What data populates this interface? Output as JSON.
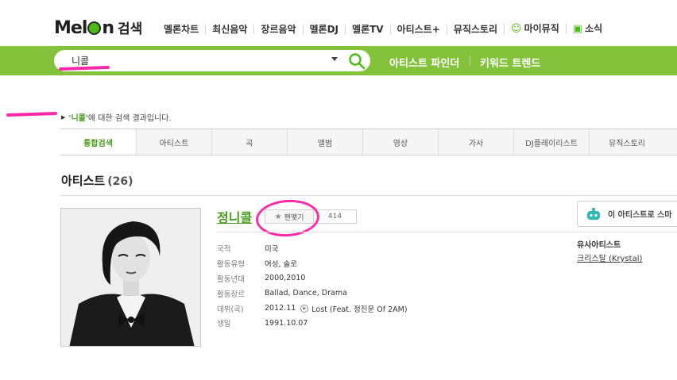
{
  "header": {
    "logo_text": "MelOn",
    "logo_search_label": "검색",
    "nav": [
      {
        "label": "멜론차트"
      },
      {
        "label": "최신음악"
      },
      {
        "label": "장르음악"
      },
      {
        "label": "멜론DJ"
      },
      {
        "label": "멜론TV"
      },
      {
        "label": "아티스트+"
      },
      {
        "label": "뮤직스토리"
      },
      {
        "label": "마이뮤직",
        "icon": "user-icon"
      },
      {
        "label": "소식",
        "icon": "chat-icon"
      }
    ]
  },
  "searchbar": {
    "query": "니콜",
    "links": [
      "아티스트 파인더",
      "키워드 트렌드"
    ]
  },
  "result": {
    "keyword": "'니콜'",
    "suffix": "에 대한 검색 결과입니다."
  },
  "tabs": [
    "통합검색",
    "아티스트",
    "곡",
    "앨범",
    "영상",
    "가사",
    "DJ플레이리스트",
    "뮤직스토리"
  ],
  "active_tab": "통합검색",
  "section": {
    "title": "아티스트",
    "count": "(26)"
  },
  "artist": {
    "name": "정니콜",
    "fav_label": "팬맺기",
    "fav_count": "414",
    "info": [
      {
        "label": "국적",
        "value": "미국"
      },
      {
        "label": "활동유형",
        "value": "여성, 솔로"
      },
      {
        "label": "활동년대",
        "value": "2000,2010"
      },
      {
        "label": "활동장르",
        "value": "Ballad, Dance, Drama"
      },
      {
        "label": "데뷔(곡)",
        "value": "2012.11",
        "song": "Lost (Feat. 정진운 Of 2AM)"
      },
      {
        "label": "생일",
        "value": "1991.10.07"
      }
    ]
  },
  "side": {
    "button_label": "이 아티스트로 스마",
    "similar_title": "유사아티스트",
    "similar_artist": "크리스탈 (Krystal)"
  },
  "colors": {
    "brand_green": "#84c23c",
    "link_green": "#4a9b1b",
    "annotation_pink": "#ff2aa8"
  }
}
